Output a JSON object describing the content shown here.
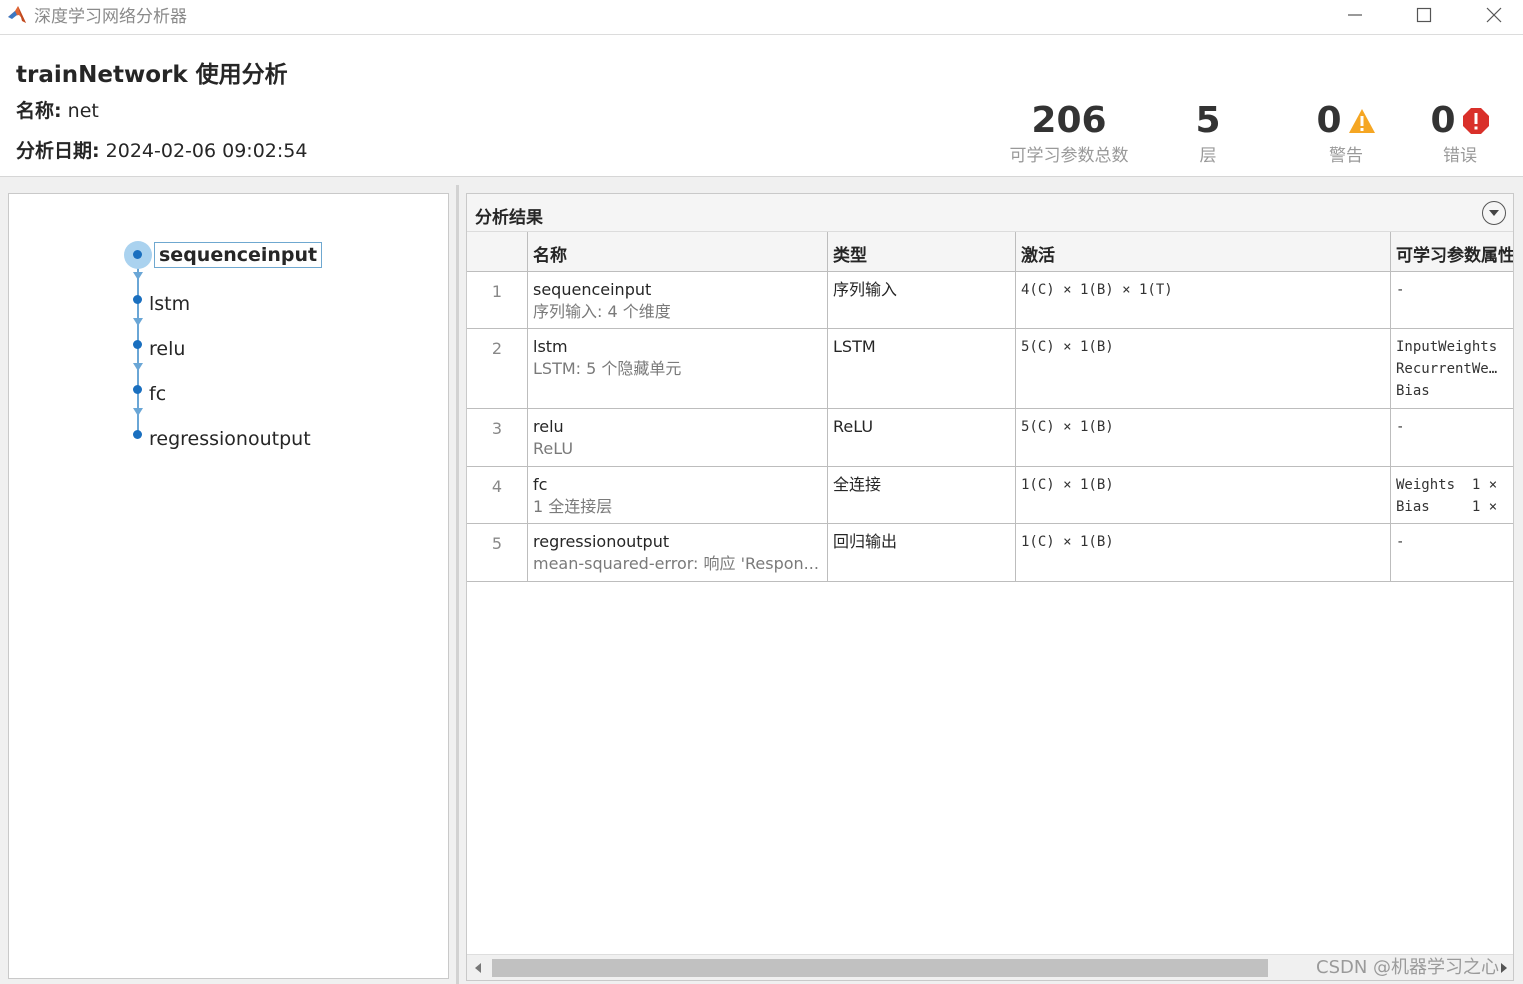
{
  "window": {
    "title": "深度学习网络分析器",
    "logo_icon": "matlab-logo-icon"
  },
  "header": {
    "title": "trainNetwork 使用分析",
    "name_label": "名称:",
    "name_value": "net",
    "date_label": "分析日期:",
    "date_value": "2024-02-06 09:02:54"
  },
  "stats": {
    "params_value": "206",
    "params_label": "可学习参数总数",
    "layers_value": "5",
    "layers_label": "层",
    "warnings_value": "0",
    "warnings_label": "警告",
    "errors_value": "0",
    "errors_label": "错误",
    "warning_color": "#f5a623",
    "error_color": "#d9302a"
  },
  "graph": {
    "nodes": [
      "sequenceinput",
      "lstm",
      "relu",
      "fc",
      "regressionoutput"
    ],
    "selected": "sequenceinput"
  },
  "results": {
    "title": "分析结果",
    "columns": [
      "",
      "名称",
      "类型",
      "激活",
      "可学习参数属性"
    ],
    "rows": [
      {
        "index": "1",
        "name": "sequenceinput",
        "desc": "序列输入: 4 个维度",
        "type": "序列输入",
        "activation": "4(C) × 1(B) × 1(T)",
        "params": [
          "-"
        ]
      },
      {
        "index": "2",
        "name": "lstm",
        "desc": "LSTM: 5 个隐藏单元",
        "type": "LSTM",
        "activation": "5(C) × 1(B)",
        "params": [
          "InputWeights",
          "RecurrentWe…",
          "Bias"
        ]
      },
      {
        "index": "3",
        "name": "relu",
        "desc": "ReLU",
        "type": "ReLU",
        "activation": "5(C) × 1(B)",
        "params": [
          "-"
        ]
      },
      {
        "index": "4",
        "name": "fc",
        "desc": "1 全连接层",
        "type": "全连接",
        "activation": "1(C) × 1(B)",
        "params": [
          "Weights  1 ×",
          "Bias     1 ×"
        ]
      },
      {
        "index": "5",
        "name": "regressionoutput",
        "desc": "mean-squared-error: 响应 'Respon...",
        "type": "回归输出",
        "activation": "1(C) × 1(B)",
        "params": [
          "-"
        ]
      }
    ]
  },
  "watermark": "CSDN @机器学习之心"
}
